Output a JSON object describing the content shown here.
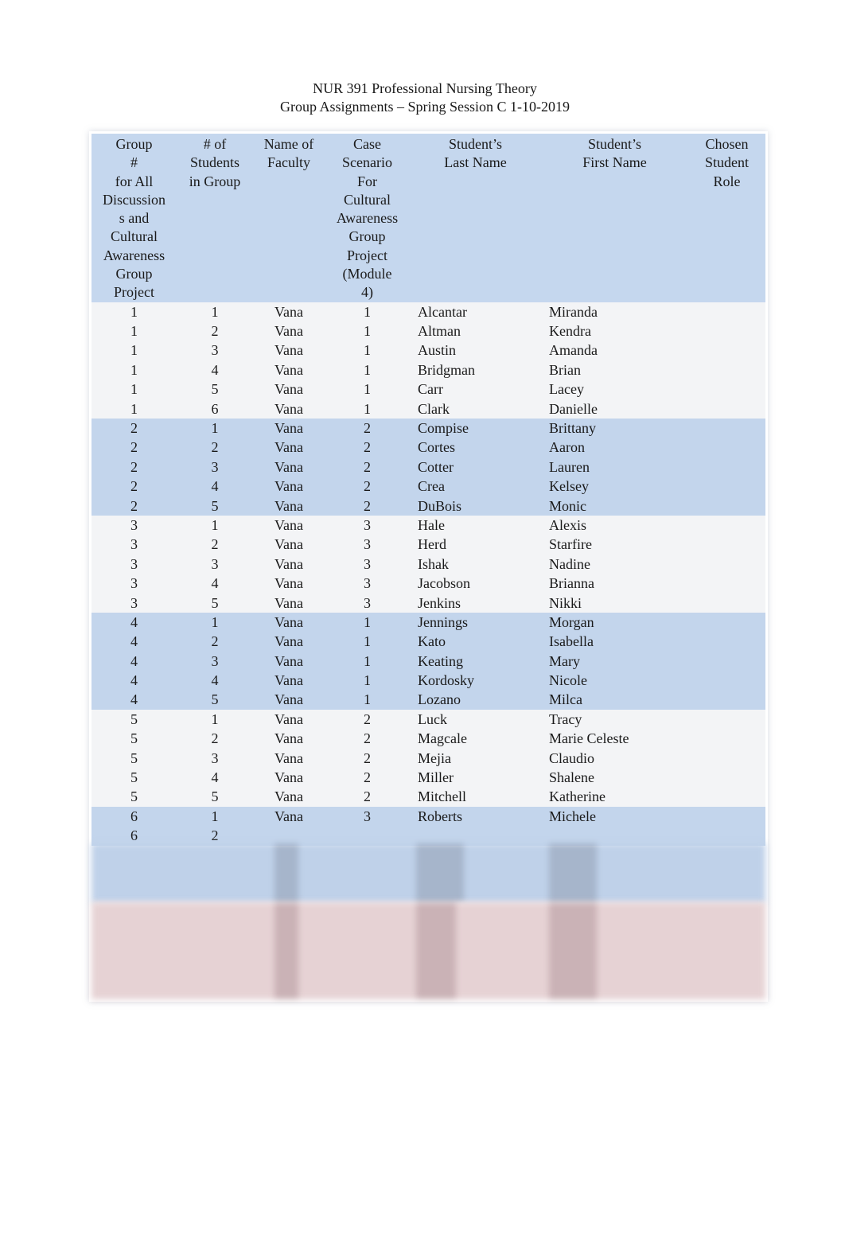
{
  "document": {
    "title_line1": "NUR 391 Professional Nursing Theory",
    "title_line2": "Group Assignments – Spring Session C 1-10-2019"
  },
  "table": {
    "headers": [
      "Group # for All Discussions and Cultural Awareness Group Project",
      "# of Students in Group",
      "Name of Faculty",
      "Case Scenario For Cultural Awareness Group Project (Module 4)",
      "Student’s Last Name",
      "Student’s First Name",
      "Chosen Student Role"
    ],
    "header_lines": [
      [
        "Group",
        "#",
        "for All",
        "Discussion",
        "s and",
        "Cultural",
        "Awareness",
        "Group",
        "Project"
      ],
      [
        "# of",
        "Students",
        "in Group"
      ],
      [
        "Name of",
        "Faculty"
      ],
      [
        "Case",
        "Scenario",
        "For",
        "Cultural",
        "Awareness",
        "Group",
        "Project",
        "(Module",
        "4)"
      ],
      [
        "Student’s",
        "Last Name"
      ],
      [
        "Student’s",
        "First Name"
      ],
      [
        "Chosen",
        "Student",
        "Role"
      ]
    ],
    "rows": [
      {
        "group": "1",
        "num": "1",
        "faculty": "Vana",
        "case": "1",
        "last": "Alcantar",
        "first": "Miranda",
        "role": ""
      },
      {
        "group": "1",
        "num": "2",
        "faculty": "Vana",
        "case": "1",
        "last": "Altman",
        "first": "Kendra",
        "role": ""
      },
      {
        "group": "1",
        "num": "3",
        "faculty": "Vana",
        "case": "1",
        "last": "Austin",
        "first": "Amanda",
        "role": ""
      },
      {
        "group": "1",
        "num": "4",
        "faculty": "Vana",
        "case": "1",
        "last": "Bridgman",
        "first": "Brian",
        "role": ""
      },
      {
        "group": "1",
        "num": "5",
        "faculty": "Vana",
        "case": "1",
        "last": "Carr",
        "first": "Lacey",
        "role": ""
      },
      {
        "group": "1",
        "num": "6",
        "faculty": "Vana",
        "case": "1",
        "last": "Clark",
        "first": "Danielle",
        "role": ""
      },
      {
        "group": "2",
        "num": "1",
        "faculty": "Vana",
        "case": "2",
        "last": "Compise",
        "first": "Brittany",
        "role": ""
      },
      {
        "group": "2",
        "num": "2",
        "faculty": "Vana",
        "case": "2",
        "last": "Cortes",
        "first": "Aaron",
        "role": ""
      },
      {
        "group": "2",
        "num": "3",
        "faculty": "Vana",
        "case": "2",
        "last": "Cotter",
        "first": "Lauren",
        "role": ""
      },
      {
        "group": "2",
        "num": "4",
        "faculty": "Vana",
        "case": "2",
        "last": "Crea",
        "first": "Kelsey",
        "role": ""
      },
      {
        "group": "2",
        "num": "5",
        "faculty": "Vana",
        "case": "2",
        "last": "DuBois",
        "first": "Monic",
        "role": ""
      },
      {
        "group": "3",
        "num": "1",
        "faculty": "Vana",
        "case": "3",
        "last": "Hale",
        "first": "Alexis",
        "role": ""
      },
      {
        "group": "3",
        "num": "2",
        "faculty": "Vana",
        "case": "3",
        "last": "Herd",
        "first": "Starfire",
        "role": ""
      },
      {
        "group": "3",
        "num": "3",
        "faculty": "Vana",
        "case": "3",
        "last": "Ishak",
        "first": "Nadine",
        "role": ""
      },
      {
        "group": "3",
        "num": "4",
        "faculty": "Vana",
        "case": "3",
        "last": "Jacobson",
        "first": "Brianna",
        "role": ""
      },
      {
        "group": "3",
        "num": "5",
        "faculty": "Vana",
        "case": "3",
        "last": "Jenkins",
        "first": "Nikki",
        "role": ""
      },
      {
        "group": "4",
        "num": "1",
        "faculty": "Vana",
        "case": "1",
        "last": "Jennings",
        "first": "Morgan",
        "role": ""
      },
      {
        "group": "4",
        "num": "2",
        "faculty": "Vana",
        "case": "1",
        "last": "Kato",
        "first": "Isabella",
        "role": ""
      },
      {
        "group": "4",
        "num": "3",
        "faculty": "Vana",
        "case": "1",
        "last": "Keating",
        "first": "Mary",
        "role": ""
      },
      {
        "group": "4",
        "num": "4",
        "faculty": "Vana",
        "case": "1",
        "last": "Kordosky",
        "first": "Nicole",
        "role": ""
      },
      {
        "group": "4",
        "num": "5",
        "faculty": "Vana",
        "case": "1",
        "last": "Lozano",
        "first": "Milca",
        "role": ""
      },
      {
        "group": "5",
        "num": "1",
        "faculty": "Vana",
        "case": "2",
        "last": "Luck",
        "first": "Tracy",
        "role": ""
      },
      {
        "group": "5",
        "num": "2",
        "faculty": "Vana",
        "case": "2",
        "last": "Magcale",
        "first": "Marie Celeste",
        "role": ""
      },
      {
        "group": "5",
        "num": "3",
        "faculty": "Vana",
        "case": "2",
        "last": "Mejia",
        "first": "Claudio",
        "role": ""
      },
      {
        "group": "5",
        "num": "4",
        "faculty": "Vana",
        "case": "2",
        "last": "Miller",
        "first": "Shalene",
        "role": ""
      },
      {
        "group": "5",
        "num": "5",
        "faculty": "Vana",
        "case": "2",
        "last": "Mitchell",
        "first": "Katherine",
        "role": ""
      },
      {
        "group": "6",
        "num": "1",
        "faculty": "Vana",
        "case": "3",
        "last": "Roberts",
        "first": "Michele",
        "role": ""
      },
      {
        "group": "6",
        "num": "2",
        "faculty": "",
        "case": "",
        "last": "",
        "first": "",
        "role": ""
      }
    ]
  },
  "colors": {
    "header_bg": "#c5d7ee",
    "band_blue": "#c3d5ec",
    "band_light": "#f3f4f6",
    "blurred_pink": "#e6d2d4"
  }
}
